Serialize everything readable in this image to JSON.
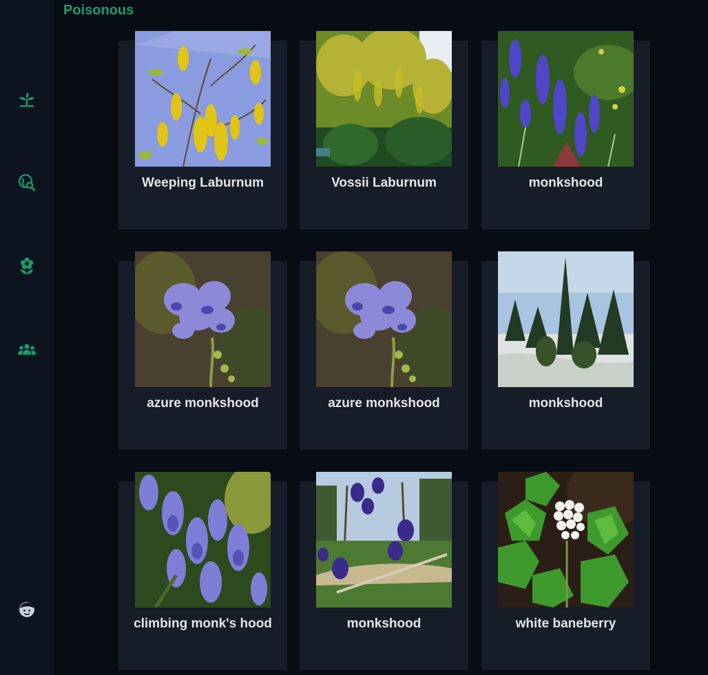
{
  "sidebar": {
    "items": [
      {
        "icon": "plant-sprout-icon"
      },
      {
        "icon": "globe-search-icon"
      },
      {
        "icon": "flower-icon"
      },
      {
        "icon": "community-group-icon"
      }
    ],
    "profile_icon": "smiley-face-icon",
    "accent_color": "#14a06f"
  },
  "section": {
    "title": "Poisonous"
  },
  "plants": [
    {
      "name": "Weeping Laburnum"
    },
    {
      "name": "Vossii Laburnum"
    },
    {
      "name": "monkshood"
    },
    {
      "name": "azure monkshood"
    },
    {
      "name": "azure monkshood"
    },
    {
      "name": "monkshood"
    },
    {
      "name": "climbing monk's hood"
    },
    {
      "name": "monkshood"
    },
    {
      "name": "white baneberry"
    }
  ]
}
